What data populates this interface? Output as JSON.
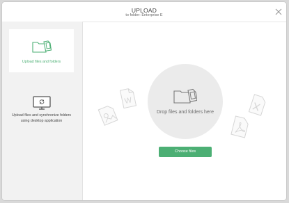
{
  "header": {
    "title": "UPLOAD",
    "subtitle": "to folder: Enterprise E"
  },
  "sidebar": {
    "options": [
      {
        "label": "Upload files and folders",
        "icon": "folder-files-icon",
        "active": true
      },
      {
        "label": "Upload files and synchronize folders using desktop application",
        "icon": "monitor-sync-icon",
        "active": false
      }
    ]
  },
  "dropzone": {
    "text": "Drop files and folders here",
    "button_label": "Choose files"
  },
  "colors": {
    "accent": "#4caf74",
    "sidebar_bg": "#f2f2f2",
    "circle_bg": "#ebebeb"
  }
}
